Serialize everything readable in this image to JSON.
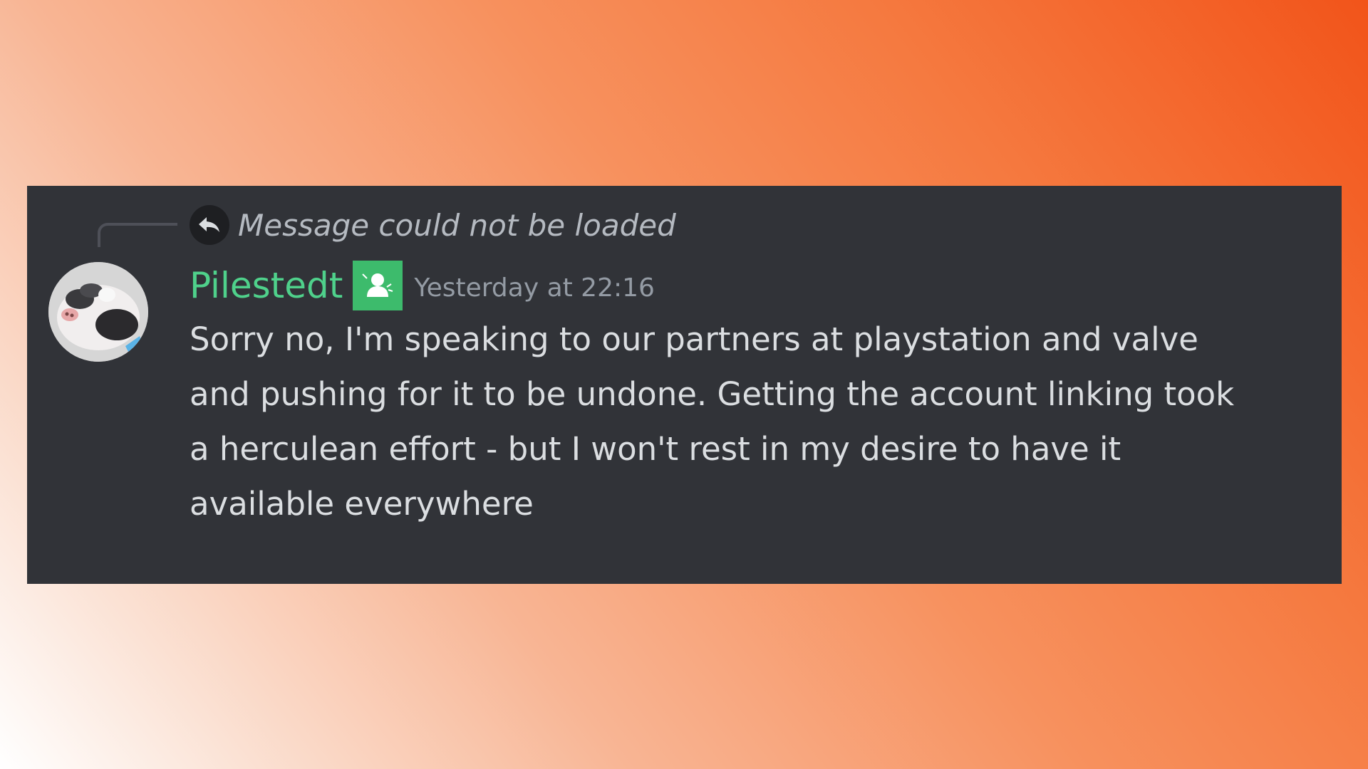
{
  "reply": {
    "icon": "reply-arrow-icon",
    "text": "Message could not be loaded"
  },
  "author": {
    "avatar_icon": "pig-avatar",
    "username": "Pilestedt",
    "role_icon": "person-role-icon",
    "username_color": "#4fd18b",
    "role_badge_color": "#3dbb6c"
  },
  "message": {
    "timestamp": "Yesterday at 22:16",
    "text": "Sorry no, I'm speaking to our partners at playstation and valve and pushing for it to be undone. Getting the account linking took a herculean effort - but I won't rest in my desire to have it available everywhere"
  },
  "colors": {
    "card_background": "#313338",
    "gradient_start": "#ffffff",
    "gradient_end": "#f2541a"
  }
}
